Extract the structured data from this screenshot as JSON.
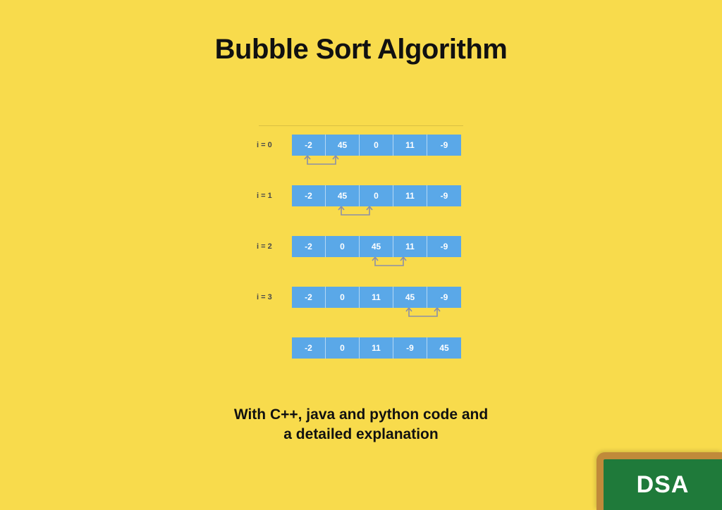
{
  "title": "Bubble Sort Algorithm",
  "subtitle_line1": "With C++, java and python  code and",
  "subtitle_line2": "a detailed explanation",
  "badge": "DSA",
  "steps": [
    {
      "label": "i = 0",
      "values": [
        "-2",
        "45",
        "0",
        "11",
        "-9"
      ],
      "swap": [
        0,
        1
      ]
    },
    {
      "label": "i = 1",
      "values": [
        "-2",
        "45",
        "0",
        "11",
        "-9"
      ],
      "swap": [
        1,
        2
      ]
    },
    {
      "label": "i = 2",
      "values": [
        "-2",
        "0",
        "45",
        "11",
        "-9"
      ],
      "swap": [
        2,
        3
      ]
    },
    {
      "label": "i = 3",
      "values": [
        "-2",
        "0",
        "11",
        "45",
        "-9"
      ],
      "swap": [
        3,
        4
      ]
    },
    {
      "label": "",
      "values": [
        "-2",
        "0",
        "11",
        "-9",
        "45"
      ],
      "swap": null
    }
  ],
  "colors": {
    "background": "#f8db4c",
    "cell": "#5aa8e8",
    "connector": "#8a8fa8",
    "badge_bg": "#1f7a3a",
    "badge_border": "#c08a3a"
  }
}
